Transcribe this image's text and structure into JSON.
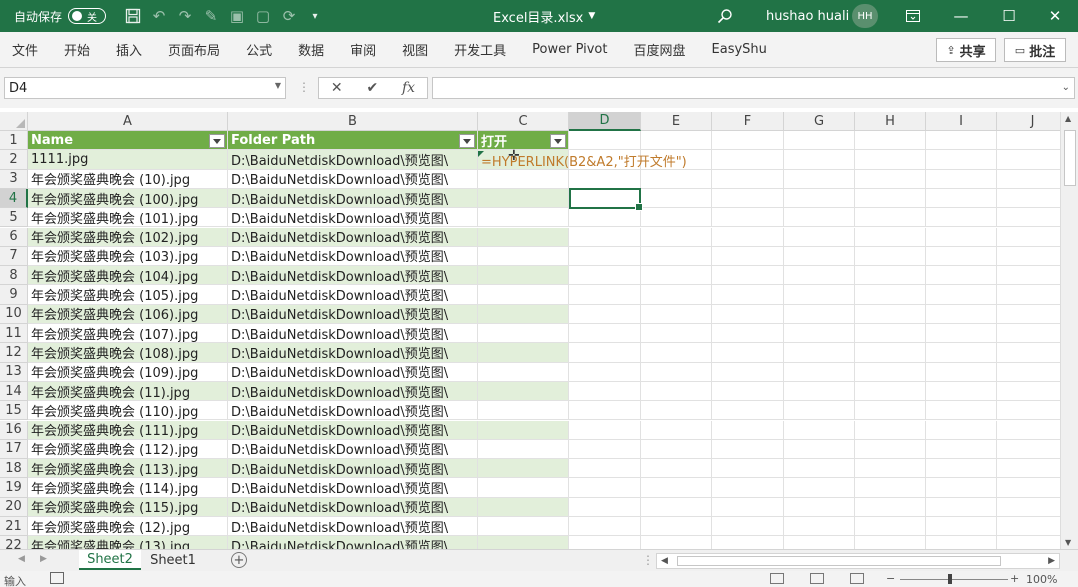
{
  "titlebar": {
    "autosave_label": "自动保存",
    "autosave_state": "关",
    "filename": "Excel目录.xlsx",
    "user_name": "hushao huali",
    "user_initials": "HH"
  },
  "ribbon": {
    "tabs": [
      "文件",
      "开始",
      "插入",
      "页面布局",
      "公式",
      "数据",
      "审阅",
      "视图",
      "开发工具",
      "Power Pivot",
      "百度网盘",
      "EasyShu"
    ],
    "share_label": "共享",
    "comment_label": "批注"
  },
  "formula_bar": {
    "name_box": "D4",
    "formula": ""
  },
  "grid": {
    "columns": [
      "A",
      "B",
      "C",
      "D",
      "E",
      "F",
      "G",
      "H",
      "I",
      "J"
    ],
    "selected_column": "D",
    "selected_row": "4",
    "row_numbers": [
      "1",
      "2",
      "3",
      "4",
      "5",
      "6",
      "7",
      "8",
      "9",
      "10",
      "11",
      "12",
      "13",
      "14",
      "15",
      "16",
      "17",
      "18",
      "19",
      "20",
      "21",
      "22"
    ],
    "table_headers": [
      "Name",
      "Folder Path",
      "打开"
    ],
    "rows": [
      {
        "name": "1111.jpg",
        "path": "D:\\BaiduNetdiskDownload\\预览图\\",
        "open": ""
      },
      {
        "name": "年会颁奖盛典晚会 (10).jpg",
        "path": "D:\\BaiduNetdiskDownload\\预览图\\",
        "open": ""
      },
      {
        "name": "年会颁奖盛典晚会 (100).jpg",
        "path": "D:\\BaiduNetdiskDownload\\预览图\\",
        "open": ""
      },
      {
        "name": "年会颁奖盛典晚会 (101).jpg",
        "path": "D:\\BaiduNetdiskDownload\\预览图\\",
        "open": ""
      },
      {
        "name": "年会颁奖盛典晚会 (102).jpg",
        "path": "D:\\BaiduNetdiskDownload\\预览图\\",
        "open": ""
      },
      {
        "name": "年会颁奖盛典晚会 (103).jpg",
        "path": "D:\\BaiduNetdiskDownload\\预览图\\",
        "open": ""
      },
      {
        "name": "年会颁奖盛典晚会 (104).jpg",
        "path": "D:\\BaiduNetdiskDownload\\预览图\\",
        "open": ""
      },
      {
        "name": "年会颁奖盛典晚会 (105).jpg",
        "path": "D:\\BaiduNetdiskDownload\\预览图\\",
        "open": ""
      },
      {
        "name": "年会颁奖盛典晚会 (106).jpg",
        "path": "D:\\BaiduNetdiskDownload\\预览图\\",
        "open": ""
      },
      {
        "name": "年会颁奖盛典晚会 (107).jpg",
        "path": "D:\\BaiduNetdiskDownload\\预览图\\",
        "open": ""
      },
      {
        "name": "年会颁奖盛典晚会 (108).jpg",
        "path": "D:\\BaiduNetdiskDownload\\预览图\\",
        "open": ""
      },
      {
        "name": "年会颁奖盛典晚会 (109).jpg",
        "path": "D:\\BaiduNetdiskDownload\\预览图\\",
        "open": ""
      },
      {
        "name": "年会颁奖盛典晚会 (11).jpg",
        "path": "D:\\BaiduNetdiskDownload\\预览图\\",
        "open": ""
      },
      {
        "name": "年会颁奖盛典晚会 (110).jpg",
        "path": "D:\\BaiduNetdiskDownload\\预览图\\",
        "open": ""
      },
      {
        "name": "年会颁奖盛典晚会 (111).jpg",
        "path": "D:\\BaiduNetdiskDownload\\预览图\\",
        "open": ""
      },
      {
        "name": "年会颁奖盛典晚会 (112).jpg",
        "path": "D:\\BaiduNetdiskDownload\\预览图\\",
        "open": ""
      },
      {
        "name": "年会颁奖盛典晚会 (113).jpg",
        "path": "D:\\BaiduNetdiskDownload\\预览图\\",
        "open": ""
      },
      {
        "name": "年会颁奖盛典晚会 (114).jpg",
        "path": "D:\\BaiduNetdiskDownload\\预览图\\",
        "open": ""
      },
      {
        "name": "年会颁奖盛典晚会 (115).jpg",
        "path": "D:\\BaiduNetdiskDownload\\预览图\\",
        "open": ""
      },
      {
        "name": "年会颁奖盛典晚会 (12).jpg",
        "path": "D:\\BaiduNetdiskDownload\\预览图\\",
        "open": ""
      },
      {
        "name": "年会颁奖盛典晚会 (13).jpg",
        "path": "D:\\BaiduNetdiskDownload\\预览图\\",
        "open": ""
      }
    ],
    "c2_formula": "=HYPERLINK(B2&A2,\"打开文件\")"
  },
  "sheets": {
    "tabs": [
      "Sheet2",
      "Sheet1"
    ],
    "active": "Sheet2"
  },
  "statusbar": {
    "mode": "输入",
    "zoom": "100%"
  },
  "colors": {
    "accent": "#217346",
    "table_header": "#70ad47",
    "table_band": "#e2efda",
    "formula_text": "#c07b2c"
  }
}
